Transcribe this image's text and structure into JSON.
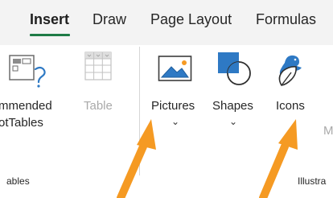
{
  "tabs": [
    {
      "label": "Insert",
      "active": true
    },
    {
      "label": "Draw"
    },
    {
      "label": "Page Layout"
    },
    {
      "label": "Formulas"
    }
  ],
  "ribbon": {
    "recommended_label_line1": "mmended",
    "recommended_label_line2": "otTables",
    "table_label": "Table",
    "pictures_label": "Pictures",
    "shapes_label": "Shapes",
    "icons_label": "Icons",
    "group_tables_partial": "ables",
    "group_illustrations_partial": "Illustra",
    "cut_m": "M"
  },
  "annotations": {
    "arrow_color": "#f59a23",
    "accent_tab_underline": "#1e7b46"
  }
}
